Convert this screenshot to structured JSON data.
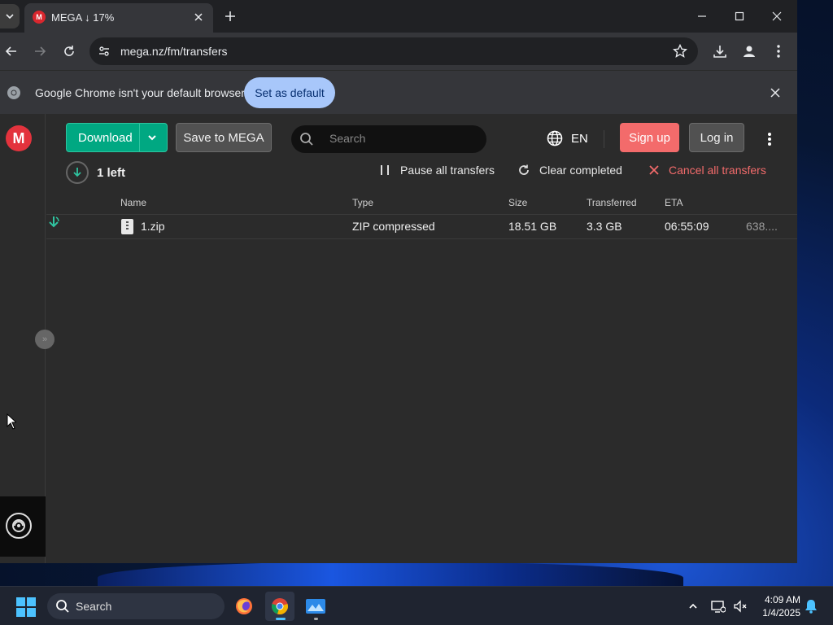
{
  "browser": {
    "tab": {
      "title": "MEGA ↓ 17%",
      "favicon_letter": "M"
    },
    "url": "mega.nz/fm/transfers",
    "infobar": {
      "message": "Google Chrome isn't your default browser",
      "set_default_label": "Set as default"
    }
  },
  "mega": {
    "logo_letter": "M",
    "header": {
      "download_label": "Download",
      "save_label": "Save to MEGA",
      "search_placeholder": "Search",
      "language": "EN",
      "signup_label": "Sign up",
      "login_label": "Log in"
    },
    "transfers": {
      "left_count": "1 left",
      "pause_all_label": "Pause all transfers",
      "clear_completed_label": "Clear completed",
      "cancel_all_label": "Cancel all transfers",
      "columns": [
        "Name",
        "Type",
        "Size",
        "Transferred",
        "ETA"
      ],
      "rows": [
        {
          "name": "1.zip",
          "type": "ZIP compressed",
          "size": "18.51 GB",
          "transferred": "3.3 GB",
          "eta": "06:55:09",
          "speed": "638...."
        }
      ]
    }
  },
  "taskbar": {
    "search_placeholder": "Search",
    "time": "4:09 AM",
    "date": "1/4/2025",
    "apps": [
      "firefox-icon",
      "chrome-icon",
      "photos-icon"
    ]
  },
  "colors": {
    "mega_red": "#e3333d",
    "download_green": "#00a882",
    "signup_red": "#f36b6b",
    "set_default_blue": "#a8c7fa"
  }
}
